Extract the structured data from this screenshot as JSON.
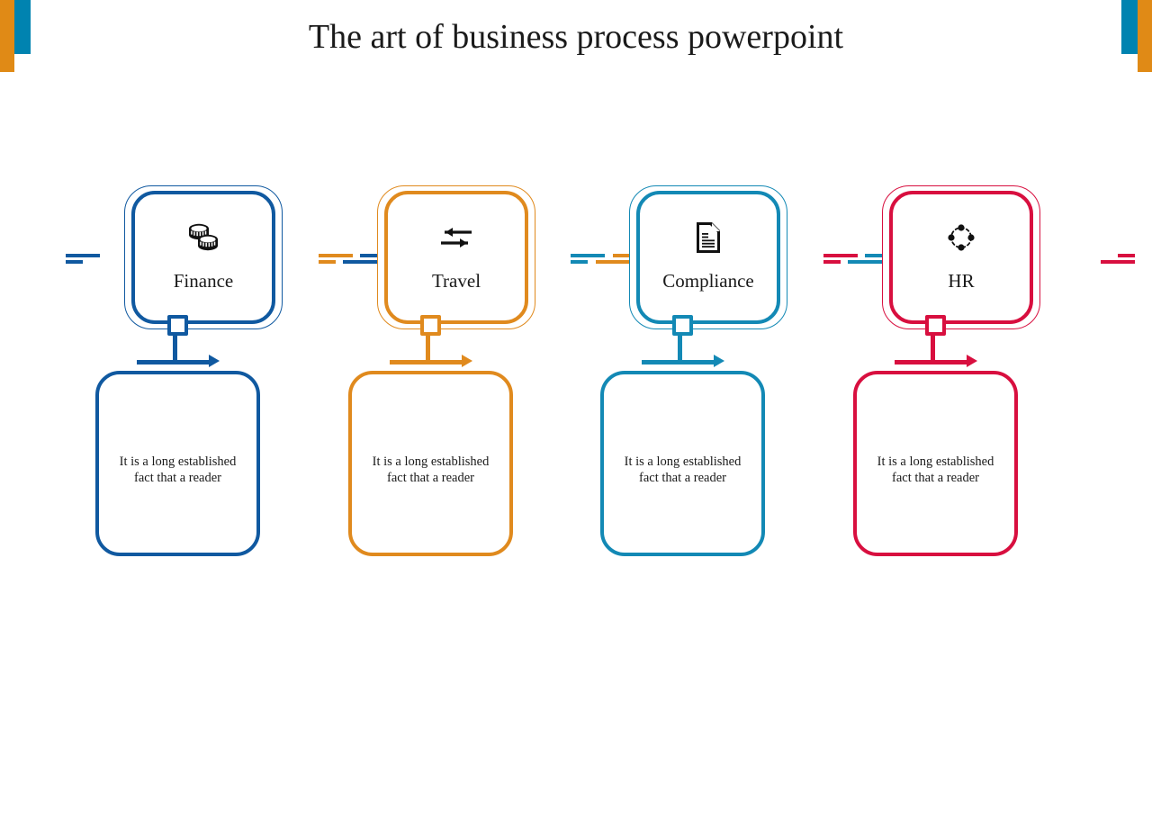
{
  "slide": {
    "title": "The art of business process powerpoint",
    "background_color": "#ffffff",
    "decor": {
      "orange": "#E08A16",
      "blue": "#0083B0"
    }
  },
  "columns": [
    {
      "id": "finance",
      "color": "#1059A0",
      "icon": "coins-icon",
      "label": "Finance",
      "body": "It is a long established fact that a reader"
    },
    {
      "id": "travel",
      "color": "#E08A1E",
      "icon": "exchange-arrows-icon",
      "label": "Travel",
      "body": "It is a long established fact that a reader"
    },
    {
      "id": "compliance",
      "color": "#1389B5",
      "icon": "document-icon",
      "label": "Compliance",
      "body": "It is a long established fact that a reader"
    },
    {
      "id": "hr",
      "color": "#D80F3F",
      "icon": "network-nodes-icon",
      "label": "HR",
      "body": "It is a long established fact that a reader"
    }
  ]
}
